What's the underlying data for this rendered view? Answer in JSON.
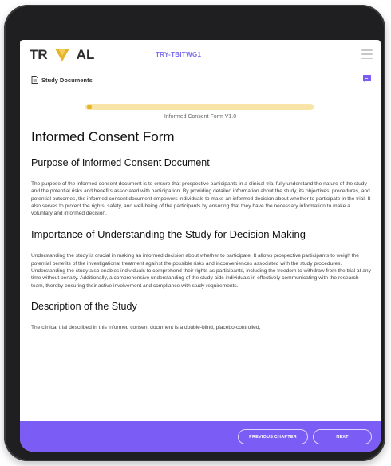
{
  "app": {
    "logo_left": "TR",
    "logo_right": "AL",
    "study_code": "TRY-TBITWG1",
    "icons": {
      "menu": "hamburger-menu-icon",
      "document": "document-icon",
      "chat": "chat-icon",
      "logo": "logo-v-icon"
    },
    "colors": {
      "accent": "#7b5cf5",
      "progress_track": "#f7e4a6",
      "progress_dot": "#e6b428",
      "study_code": "#7a6df0"
    }
  },
  "docbar": {
    "label": "Study Documents"
  },
  "progress": {
    "value": 0.0,
    "caption": "Informed Consent Form V1.0"
  },
  "document": {
    "title": "Informed Consent Form",
    "sections": [
      {
        "heading": "Purpose of Informed Consent Document",
        "body": "The purpose of the informed consent document is to ensure that prospective participants in a clinical trial fully understand the nature of the study and the potential risks and benefits associated with participation. By providing detailed information about the study, its objectives, procedures, and potential outcomes, the informed consent document empowers individuals to make an informed decision about whether to participate in the trial. It also serves to protect the rights, safety, and well-being of the participants by ensuring that they have the necessary information to make a voluntary and informed decision."
      },
      {
        "heading": "Importance of Understanding the Study for Decision Making",
        "body": "Understanding the study is crucial in making an informed decision about whether to participate. It allows prospective participants to weigh the potential benefits of the investigational treatment against the possible risks and inconveniences associated with the study procedures. Understanding the study also enables individuals to comprehend their rights as participants, including the freedom to withdraw from the trial at any time without penalty. Additionally, a comprehensive understanding of the study aids individuals in effectively communicating with the research team, thereby ensuring their active involvement and compliance with study requirements."
      },
      {
        "heading": "Description of the Study",
        "body": "The clinical trial described in this informed consent document is a double-blind, placebo-controlled,"
      }
    ]
  },
  "footer": {
    "prev_label": "PREVIOUS CHAPTER",
    "next_label": "NEXT"
  }
}
